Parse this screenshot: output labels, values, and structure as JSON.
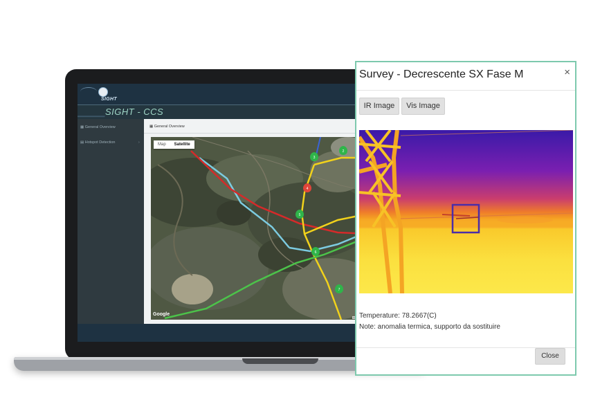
{
  "app": {
    "logo_text": "SIGHT",
    "title": "SIGHT - CCS"
  },
  "sidebar": {
    "items": [
      {
        "label": "General Overview",
        "icon": "map-icon"
      },
      {
        "label": "Hotspot Detection",
        "icon": "document-icon"
      }
    ]
  },
  "panel": {
    "header": "General Overview",
    "map_toggle": {
      "map_label": "Map",
      "satellite_label": "Satellite",
      "selected": "Satellite"
    },
    "google_label": "Google",
    "attribution": "Imagery ©2019 ..."
  },
  "map_markers": [
    {
      "label": "3",
      "color": "#2fb54a"
    },
    {
      "label": "2",
      "color": "#2fb54a"
    },
    {
      "label": "4",
      "color": "#e0453a"
    },
    {
      "label": "5",
      "color": "#2fb54a"
    },
    {
      "label": "6",
      "color": "#2fb54a"
    },
    {
      "label": "7",
      "color": "#2fb54a"
    }
  ],
  "modal": {
    "title": "Survey - Decrescente SX Fase M",
    "close_x": "×",
    "tabs": [
      {
        "label": "IR Image"
      },
      {
        "label": "Vis Image"
      }
    ],
    "temperature_label": "Temperature: 78.2667(C)",
    "note_label": "Note: anomalia termica, supporto da sostituire",
    "close_button": "Close"
  },
  "colors": {
    "modal_border": "#7dc9ad",
    "app_dark": "#1e3242",
    "line_red": "#d52a2a",
    "line_yellow": "#f2d21b",
    "line_cyan": "#7ccbe0",
    "line_green": "#4cc34a"
  }
}
